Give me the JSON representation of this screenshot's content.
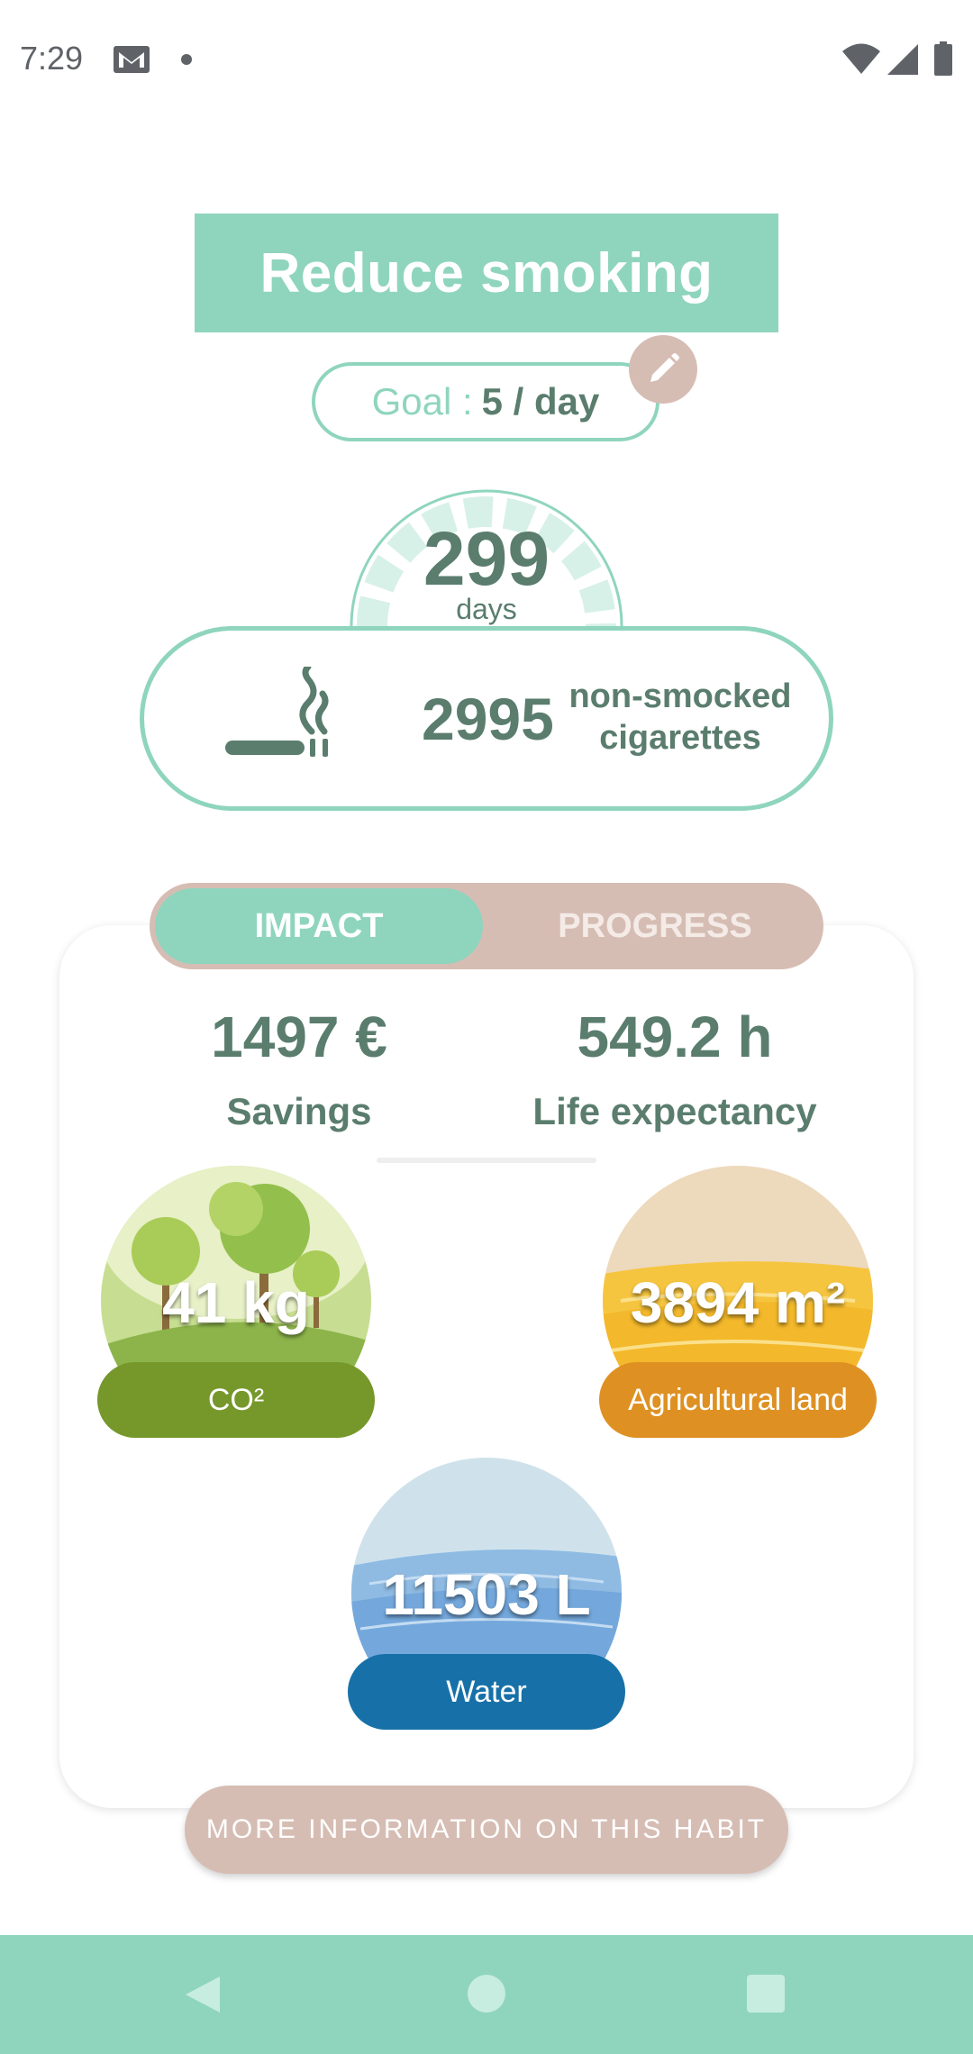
{
  "status_bar": {
    "time": "7:29"
  },
  "header": {
    "title": "Reduce smoking",
    "goal_label": "Goal :",
    "goal_value": "5 / day"
  },
  "counter": {
    "days_value": "299",
    "days_label": "days",
    "cigarettes_value": "2995",
    "cigarettes_label_line1": "non-smocked",
    "cigarettes_label_line2": "cigarettes"
  },
  "tabs": {
    "impact": "IMPACT",
    "progress": "PROGRESS",
    "active": "IMPACT"
  },
  "stats": {
    "savings_value": "1497 €",
    "savings_label": "Savings",
    "life_value": "549.2 h",
    "life_label": "Life expectancy"
  },
  "impacts": {
    "co2_value": "41 kg",
    "co2_label": "CO²",
    "land_value": "3894 m²",
    "land_label": "Agricultural land",
    "water_value": "11503 L",
    "water_label": "Water"
  },
  "more_button": "MORE INFORMATION ON THIS HABIT",
  "colors": {
    "accent": "#8fd5bd",
    "text_dark": "#5a7d6e",
    "secondary": "#d6bdb4",
    "co2": "#76982a",
    "land": "#de9122",
    "water": "#1771a8"
  },
  "icons": [
    "gmail-icon",
    "wifi-icon",
    "signal-icon",
    "battery-icon",
    "pencil-icon",
    "cigarette-icon",
    "back-icon",
    "home-icon",
    "recents-icon"
  ]
}
